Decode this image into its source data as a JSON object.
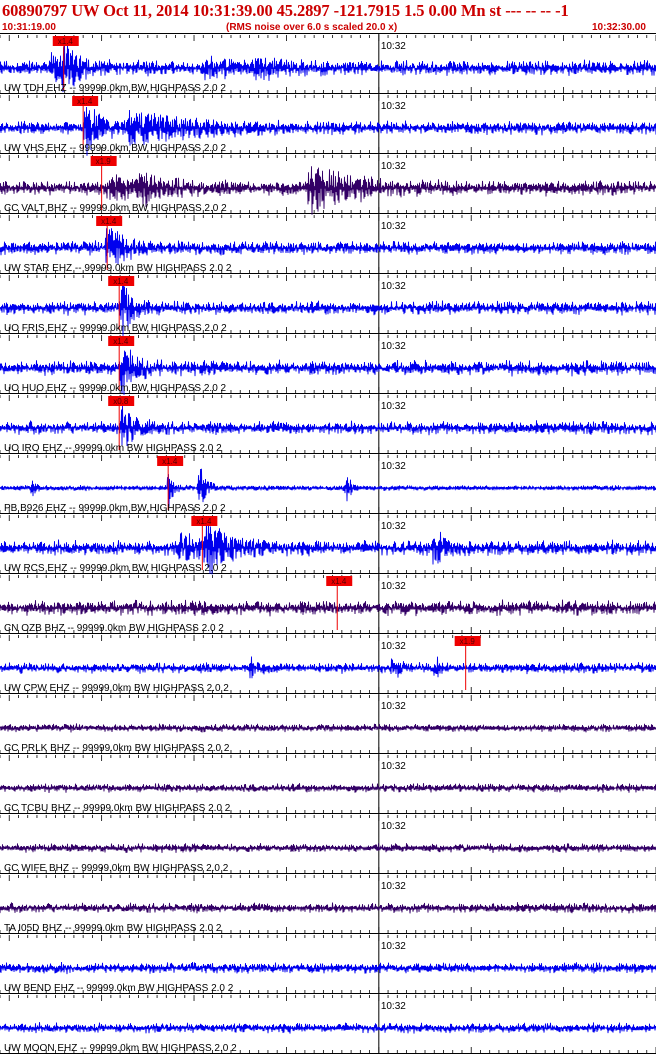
{
  "header": {
    "title": "60890797 UW Oct 11, 2014 10:31:39.00   45.2897 -121.7915  1.5 0.00 Mn st --- -- --  -1",
    "start_time": "10:31:19.00",
    "scale_note": "(RMS noise over 6.0 s scaled 20.0 x)",
    "end_time": "10:32:30.00"
  },
  "minute_label": "10:32",
  "colors": {
    "header": "#cc0000",
    "trace_blue": "#0000ee",
    "trace_dark": "#330066",
    "pick": "#ee0000"
  },
  "chart_data": {
    "type": "seismogram",
    "title": "60890797 UW Oct 11, 2014 10:31:39.00   45.2897 -121.7915  1.5 0.00 Mn st --- -- --  -1",
    "x_start": "10:31:19.00",
    "x_end": "10:32:30.00",
    "x_range_seconds": [
      0,
      71
    ],
    "minute_marker": "10:32",
    "channels": [
      {
        "label": "UW TDH EHZ -- 99999.0km BW  HIGHPASS  2.0  2",
        "pick_label": "x1.4",
        "pick_time_s": 6.9,
        "color": "trace_blue",
        "noise": 0.22,
        "bursts": [
          {
            "t": 6.9,
            "amp": 0.95,
            "dur": 1.2
          },
          {
            "t": 5.5,
            "amp": 0.35,
            "dur": 2.5
          },
          {
            "t": 22,
            "amp": 0.28,
            "dur": 3
          },
          {
            "t": 27.5,
            "amp": 0.3,
            "dur": 3
          }
        ]
      },
      {
        "label": "UW VHS EHZ -- 99999.0km BW  HIGHPASS  2.0  2",
        "pick_label": "x1.4",
        "pick_time_s": 9.0,
        "color": "trace_blue",
        "noise": 0.2,
        "bursts": [
          {
            "t": 9.3,
            "amp": 0.95,
            "dur": 1.5
          },
          {
            "t": 14,
            "amp": 0.55,
            "dur": 6
          }
        ]
      },
      {
        "label": "CC VALT BHZ -- 99999.0km BW  HIGHPASS  2.0  2",
        "pick_label": "x1.9",
        "pick_time_s": 11.0,
        "color": "trace_dark",
        "noise": 0.22,
        "bursts": [
          {
            "t": 11.5,
            "amp": 0.4,
            "dur": 2.5
          },
          {
            "t": 15,
            "amp": 0.45,
            "dur": 3
          },
          {
            "t": 33.5,
            "amp": 1.0,
            "dur": 4
          }
        ]
      },
      {
        "label": "UW STAR EHZ -- 99999.0km BW  HIGHPASS  2.0  2",
        "pick_label": "x1.4",
        "pick_time_s": 11.6,
        "color": "trace_blue",
        "noise": 0.2,
        "bursts": [
          {
            "t": 11.6,
            "amp": 0.9,
            "dur": 1.8
          }
        ]
      },
      {
        "label": "UO FRIS EHZ -- 99999.0km BW  HIGHPASS  2.0  2",
        "pick_label": "x1.4",
        "pick_time_s": 12.9,
        "color": "trace_blue",
        "noise": 0.2,
        "bursts": [
          {
            "t": 13.2,
            "amp": 1.0,
            "dur": 1.2
          }
        ]
      },
      {
        "label": "UO HUO EHZ -- 99999.0km BW  HIGHPASS  2.0  2",
        "pick_label": "x1.4",
        "pick_time_s": 12.9,
        "color": "trace_blue",
        "noise": 0.22,
        "bursts": [
          {
            "t": 13.2,
            "amp": 1.0,
            "dur": 1.2
          }
        ]
      },
      {
        "label": "UO IRO EHZ -- 99999.0km BW  HIGHPASS  2.0  2",
        "pick_label": "x0.8",
        "pick_time_s": 12.9,
        "color": "trace_blue",
        "noise": 0.2,
        "bursts": [
          {
            "t": 13.2,
            "amp": 0.9,
            "dur": 1.2
          }
        ]
      },
      {
        "label": "PB B926 EHZ -- 99999.0km BW  HIGHPASS  2.0  2",
        "pick_label": "x1.4",
        "pick_time_s": 18.2,
        "color": "trace_blue",
        "noise": 0.08,
        "bursts": [
          {
            "t": 18.2,
            "amp": 0.75,
            "dur": 0.5
          },
          {
            "t": 21.6,
            "amp": 1.0,
            "dur": 0.6
          },
          {
            "t": 3.5,
            "amp": 0.3,
            "dur": 0.4
          },
          {
            "t": 37.5,
            "amp": 0.7,
            "dur": 0.4
          }
        ]
      },
      {
        "label": "UW RCS EHZ -- 99999.0km BW  HIGHPASS  2.0  2",
        "pick_label": "x1.4",
        "pick_time_s": 21.9,
        "color": "trace_blue",
        "noise": 0.22,
        "bursts": [
          {
            "t": 22.3,
            "amp": 0.95,
            "dur": 2.2
          },
          {
            "t": 19.5,
            "amp": 0.45,
            "dur": 3
          },
          {
            "t": 47,
            "amp": 0.6,
            "dur": 1.2
          }
        ]
      },
      {
        "label": "CN OZB BHZ -- 99999.0km BW  HIGHPASS  2.0  2",
        "pick_label": "x1.4",
        "pick_time_s": 36.5,
        "color": "trace_dark",
        "noise": 0.22,
        "bursts": []
      },
      {
        "label": "UW CPW EHZ -- 99999.0km BW  HIGHPASS  2.0  2",
        "pick_label": "x1.9",
        "pick_time_s": 50.4,
        "color": "trace_blue",
        "noise": 0.16,
        "bursts": [
          {
            "t": 42.5,
            "amp": 0.45,
            "dur": 0.6
          },
          {
            "t": 27.2,
            "amp": 0.35,
            "dur": 0.5
          },
          {
            "t": 47.2,
            "amp": 0.35,
            "dur": 0.5
          }
        ]
      },
      {
        "label": "CC PRLK BHZ -- 99999.0km BW  HIGHPASS  2.0  2",
        "pick_label": "",
        "pick_time_s": null,
        "color": "trace_dark",
        "noise": 0.12,
        "bursts": []
      },
      {
        "label": "CC TCBU BHZ -- 99999.0km BW  HIGHPASS  2.0  2",
        "pick_label": "",
        "pick_time_s": null,
        "color": "trace_dark",
        "noise": 0.13,
        "bursts": []
      },
      {
        "label": "CC WIFE BHZ -- 99999.0km BW  HIGHPASS  2.0  2",
        "pick_label": "",
        "pick_time_s": null,
        "color": "trace_dark",
        "noise": 0.13,
        "bursts": []
      },
      {
        "label": "TA I05D BHZ -- 99999.0km BW  HIGHPASS  2.0  2",
        "pick_label": "",
        "pick_time_s": null,
        "color": "trace_dark",
        "noise": 0.15,
        "bursts": []
      },
      {
        "label": "UW BEND EHZ -- 99999.0km BW  HIGHPASS  2.0  2",
        "pick_label": "",
        "pick_time_s": null,
        "color": "trace_blue",
        "noise": 0.16,
        "bursts": []
      },
      {
        "label": "UW MOON EHZ -- 99999.0km BW  HIGHPASS  2.0  2",
        "pick_label": "",
        "pick_time_s": null,
        "color": "trace_blue",
        "noise": 0.15,
        "bursts": []
      }
    ]
  }
}
